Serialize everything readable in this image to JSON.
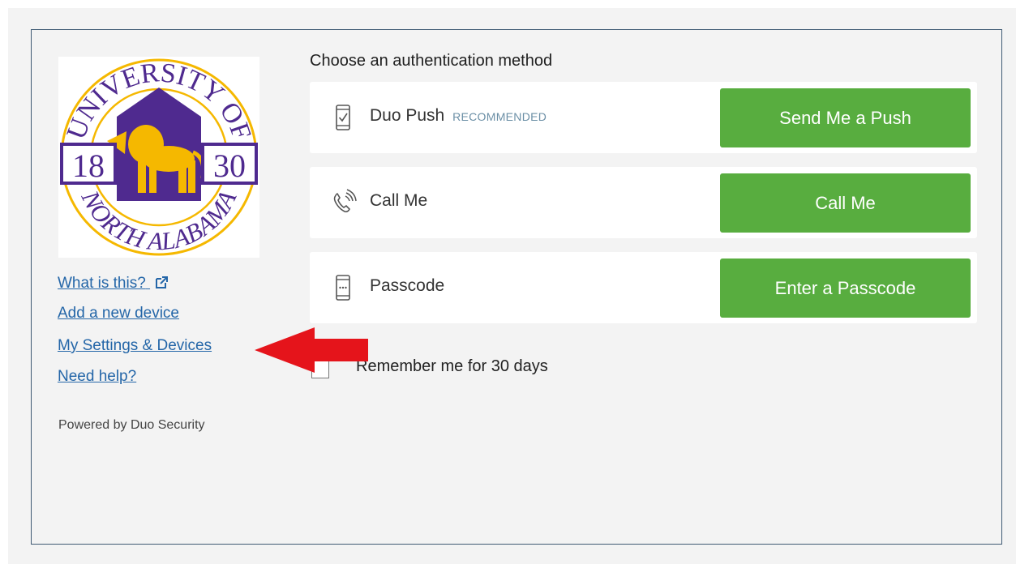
{
  "logo": {
    "top_text": "UNIVERSITY OF",
    "bottom_text": "NORTH ALABAMA",
    "year_left": "18",
    "year_right": "30",
    "colors": {
      "purple": "#4f2a8f",
      "gold": "#f5b800"
    }
  },
  "sidebar": {
    "links": [
      {
        "label": "What is this?",
        "icon": "external-link-icon"
      },
      {
        "label": "Add a new device"
      },
      {
        "label": "My Settings & Devices"
      },
      {
        "label": "Need help?"
      }
    ],
    "powered_by": "Powered by Duo Security"
  },
  "auth": {
    "heading": "Choose an authentication method",
    "methods": [
      {
        "label": "Duo Push",
        "badge": "RECOMMENDED",
        "icon": "phone-check-icon",
        "button": "Send Me a Push"
      },
      {
        "label": "Call Me",
        "badge": "",
        "icon": "phone-call-icon",
        "button": "Call Me"
      },
      {
        "label": "Passcode",
        "badge": "",
        "icon": "passcode-device-icon",
        "button": "Enter a Passcode"
      }
    ],
    "remember_label": "Remember me for 30 days",
    "remember_checked": false
  },
  "colors": {
    "button": "#58ad3f",
    "link": "#2466a8",
    "arrow": "#e5141b",
    "frame": "#3f5a74"
  }
}
